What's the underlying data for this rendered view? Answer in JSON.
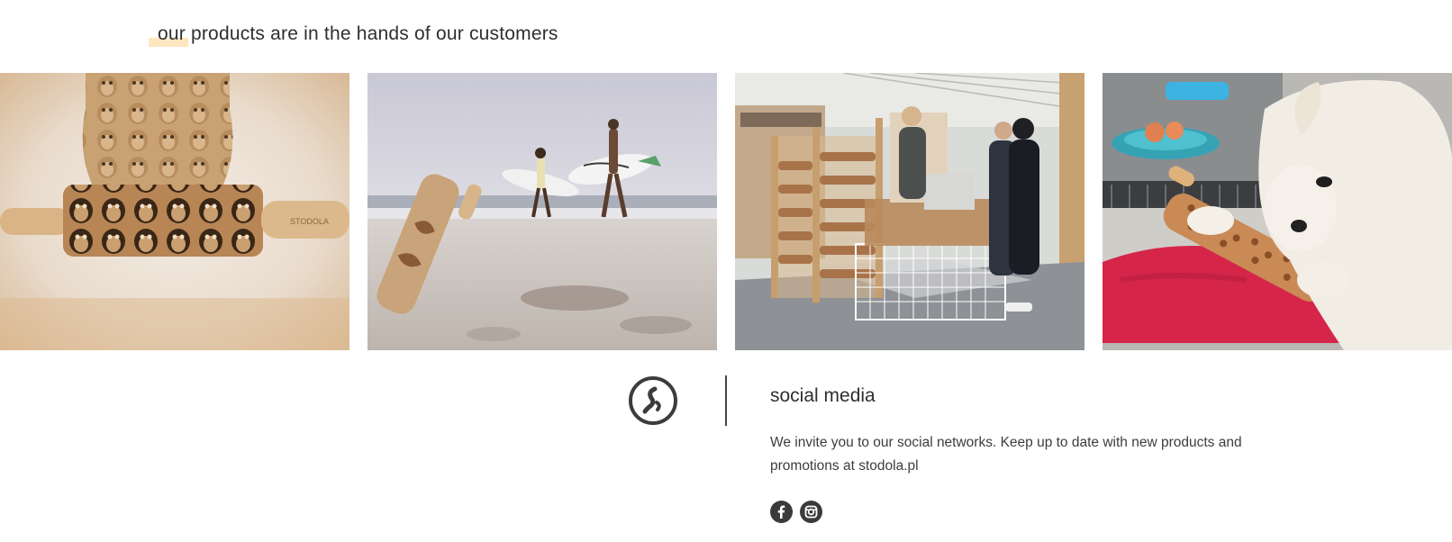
{
  "section": {
    "heading": "our products are in the hands of our customers",
    "accent_color": "#fde6c0"
  },
  "gallery": {
    "photos": [
      {
        "icon": "photo-penguin-rolling-pin",
        "engraving": "STODOLA"
      },
      {
        "icon": "photo-beach-surfers"
      },
      {
        "icon": "photo-trade-fair-stand"
      },
      {
        "icon": "photo-dog-rolling-pin"
      }
    ]
  },
  "social": {
    "logo_icon": "stodola-logo-icon",
    "title": "social media",
    "description": "We invite you to our social networks. Keep up to date with new products and promotions at stodola.pl",
    "links": [
      {
        "icon": "facebook-icon"
      },
      {
        "icon": "instagram-icon"
      }
    ]
  }
}
